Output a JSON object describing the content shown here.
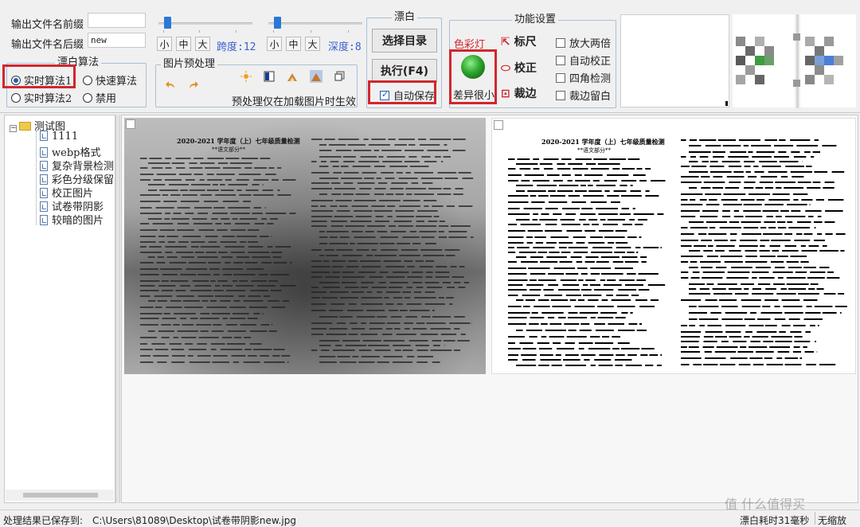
{
  "output": {
    "prefix_label": "输出文件名前缀",
    "prefix_value": "",
    "suffix_label": "输出文件名后缀",
    "suffix_value": "new"
  },
  "sliders": {
    "size_buttons": [
      "小",
      "中",
      "大"
    ],
    "span_label": "跨度:12",
    "depth_label": "深度:8"
  },
  "bleach_algo": {
    "title": "漂白算法",
    "options": [
      "实时算法1",
      "快速算法",
      "实时算法2",
      "禁用"
    ],
    "selected": "实时算法1"
  },
  "preprocess": {
    "title": "图片预处理",
    "note": "预处理仅在加载图片时生效"
  },
  "bleach": {
    "title": "漂白",
    "select_dir": "选择目录",
    "execute": "执行(F4)",
    "auto_save": "自动保存",
    "auto_save_checked": true
  },
  "functions": {
    "title": "功能设置",
    "color_light": "色彩灯",
    "light_color": "#2fa82f",
    "difference": "差异很小",
    "tools": [
      "标尺",
      "校正",
      "裁边"
    ],
    "options": [
      {
        "label": "放大两倍",
        "checked": false
      },
      {
        "label": "自动校正",
        "checked": false
      },
      {
        "label": "四角检测",
        "checked": false
      },
      {
        "label": "裁边留白",
        "checked": false
      }
    ]
  },
  "tree": {
    "root": "测试图",
    "items": [
      "1111",
      "webp格式",
      "复杂背景检测",
      "彩色分级保留",
      "校正图片",
      "试卷带阴影",
      "较暗的图片"
    ]
  },
  "document": {
    "title": "2020-2021 学年度（上）七年级质量检测",
    "subtitle": "**语文部分**"
  },
  "status": {
    "saved_label": "处理结果已保存到:",
    "saved_path": "C:\\Users\\81089\\Desktop\\试卷带阴影new.jpg",
    "time": "漂白耗时31毫秒",
    "mode": "无缩放"
  },
  "watermark": "值 什么值得买"
}
